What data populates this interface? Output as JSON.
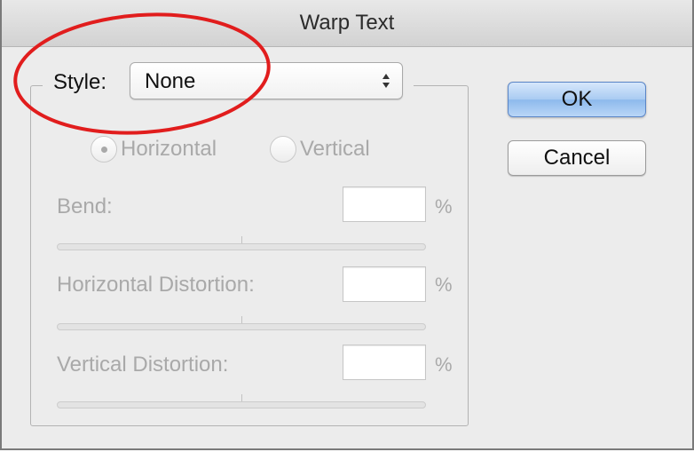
{
  "window": {
    "title": "Warp Text"
  },
  "style": {
    "label": "Style:",
    "selected": "None"
  },
  "orientation": {
    "options": [
      "Horizontal",
      "Vertical"
    ],
    "selected": "Horizontal"
  },
  "fields": {
    "bend": {
      "label": "Bend:",
      "value": "",
      "unit": "%"
    },
    "horizontal_distortion": {
      "label": "Horizontal Distortion:",
      "value": "",
      "unit": "%"
    },
    "vertical_distortion": {
      "label": "Vertical Distortion:",
      "value": "",
      "unit": "%"
    }
  },
  "buttons": {
    "ok": "OK",
    "cancel": "Cancel"
  },
  "colors": {
    "annotation": "#e11d1d",
    "disabled_text": "#a9a9a9",
    "default_button": "#a9cbf2"
  },
  "icons": {
    "select_arrows": "updown-arrows-icon"
  }
}
